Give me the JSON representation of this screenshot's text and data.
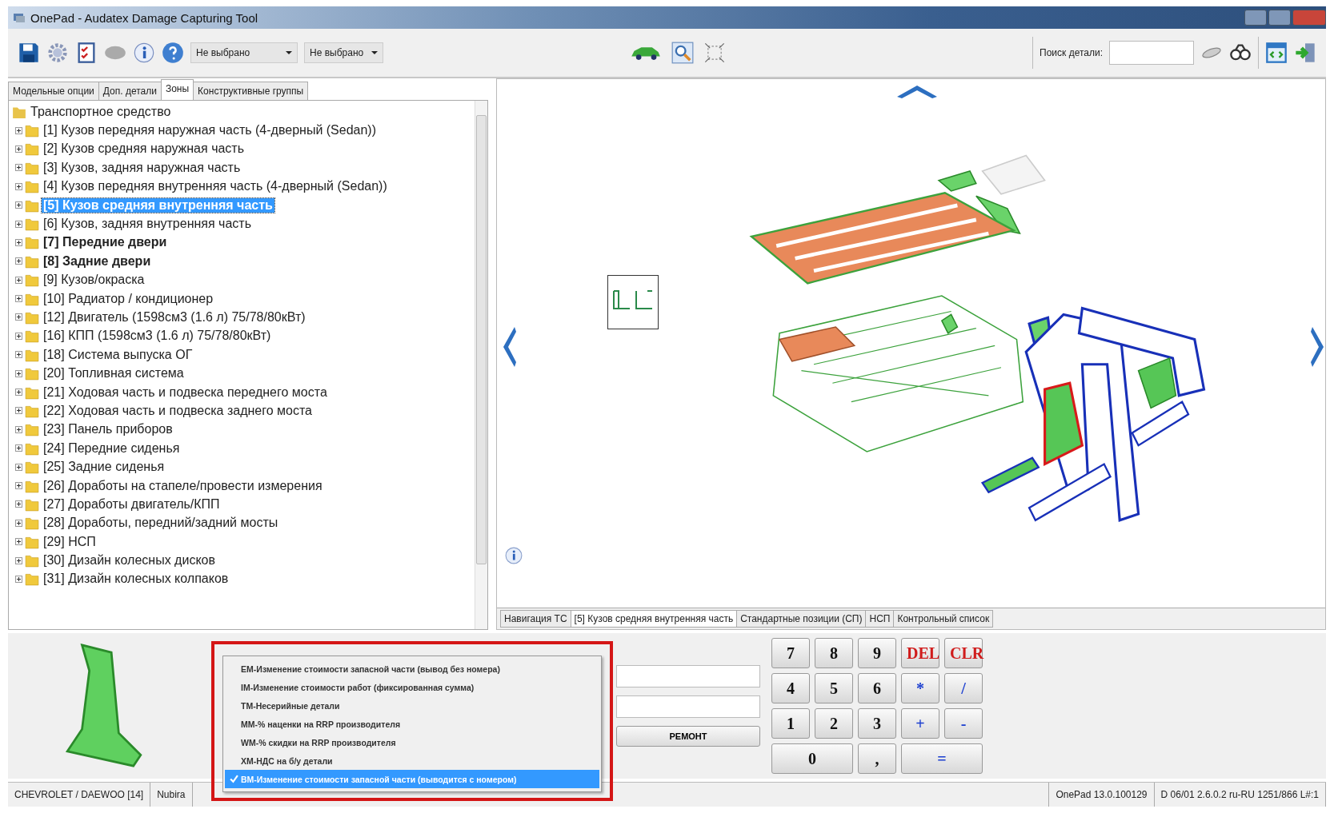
{
  "window": {
    "title": "OnePad - Audatex Damage Capturing Tool"
  },
  "toolbar": {
    "dropdowns": [
      "Не выбрано",
      "Не выбрано"
    ],
    "search_label": "Поиск детали:"
  },
  "left_tabs": [
    {
      "label": "Модельные опции",
      "selected": false
    },
    {
      "label": "Доп. детали",
      "selected": false
    },
    {
      "label": "Зоны",
      "selected": true
    },
    {
      "label": "Конструктивные группы",
      "selected": false
    }
  ],
  "tree": {
    "label": "Транспортное средство",
    "children": [
      {
        "label": "[1] Кузов передняя наружная часть (4-дверный (Sedan))",
        "selected": false,
        "bold": false
      },
      {
        "label": "[2] Кузов средняя наружная часть",
        "selected": false,
        "bold": false
      },
      {
        "label": "[3] Кузов, задняя наружная часть",
        "selected": false,
        "bold": false
      },
      {
        "label": "[4] Кузов передняя внутренняя часть (4-дверный (Sedan))",
        "selected": false,
        "bold": false
      },
      {
        "label": "[5] Кузов средняя внутренняя часть",
        "selected": true,
        "bold": true
      },
      {
        "label": "[6] Кузов, задняя внутренняя часть",
        "selected": false,
        "bold": false
      },
      {
        "label": "[7] Передние двери",
        "selected": false,
        "bold": true
      },
      {
        "label": "[8] Задние двери",
        "selected": false,
        "bold": true
      },
      {
        "label": "[9] Кузов/окраска",
        "selected": false,
        "bold": false
      },
      {
        "label": "[10] Радиатор / кондиционер",
        "selected": false,
        "bold": false
      },
      {
        "label": "[12] Двигатель (1598см3 (1.6 л) 75/78/80кВт)",
        "selected": false,
        "bold": false
      },
      {
        "label": "[16] КПП (1598см3 (1.6 л) 75/78/80кВт)",
        "selected": false,
        "bold": false
      },
      {
        "label": "[18] Система выпуска ОГ",
        "selected": false,
        "bold": false
      },
      {
        "label": "[20] Топливная система",
        "selected": false,
        "bold": false
      },
      {
        "label": "[21] Ходовая часть и подвеска переднего моста",
        "selected": false,
        "bold": false
      },
      {
        "label": "[22] Ходовая часть и подвеска заднего моста",
        "selected": false,
        "bold": false
      },
      {
        "label": "[23] Панель приборов",
        "selected": false,
        "bold": false
      },
      {
        "label": "[24] Передние сиденья",
        "selected": false,
        "bold": false
      },
      {
        "label": "[25] Задние сиденья",
        "selected": false,
        "bold": false
      },
      {
        "label": "[26] Доработы на стапеле/провести измерения",
        "selected": false,
        "bold": false
      },
      {
        "label": "[27] Доработы двигатель/КПП",
        "selected": false,
        "bold": false
      },
      {
        "label": "[28] Доработы, передний/задний мосты",
        "selected": false,
        "bold": false
      },
      {
        "label": "[29] НСП",
        "selected": false,
        "bold": false
      },
      {
        "label": "[30] Дизайн колесных дисков",
        "selected": false,
        "bold": false
      },
      {
        "label": "[31] Дизайн колесных колпаков",
        "selected": false,
        "bold": false
      }
    ]
  },
  "view_tabs": [
    {
      "label": "Навигация ТС",
      "selected": false
    },
    {
      "label": "[5] Кузов средняя внутренняя часть",
      "selected": true
    },
    {
      "label": "Стандартные позиции (СП)",
      "selected": false
    },
    {
      "label": "НСП",
      "selected": false
    },
    {
      "label": "Контрольный список",
      "selected": false
    }
  ],
  "repair_button": "РЕМОНТ",
  "keypad": [
    {
      "label": "7",
      "kind": "digit",
      "wide": false
    },
    {
      "label": "8",
      "kind": "digit",
      "wide": false
    },
    {
      "label": "9",
      "kind": "digit",
      "wide": false
    },
    {
      "label": "DEL",
      "kind": "command",
      "wide": false
    },
    {
      "label": "CLR",
      "kind": "command",
      "wide": false
    },
    {
      "label": "4",
      "kind": "digit",
      "wide": false
    },
    {
      "label": "5",
      "kind": "digit",
      "wide": false
    },
    {
      "label": "6",
      "kind": "digit",
      "wide": false
    },
    {
      "label": "*",
      "kind": "operator",
      "wide": false
    },
    {
      "label": "/",
      "kind": "operator",
      "wide": false
    },
    {
      "label": "1",
      "kind": "digit",
      "wide": false
    },
    {
      "label": "2",
      "kind": "digit",
      "wide": false
    },
    {
      "label": "3",
      "kind": "digit",
      "wide": false
    },
    {
      "label": "+",
      "kind": "operator",
      "wide": false
    },
    {
      "label": "-",
      "kind": "operator",
      "wide": false
    },
    {
      "label": "0",
      "kind": "digit",
      "wide": true
    },
    {
      "label": ",",
      "kind": "digit",
      "wide": false
    },
    {
      "label": "=",
      "kind": "operator",
      "wide": true
    }
  ],
  "popup_menu": [
    {
      "label": "EM-Изменение стоимости запасной части (вывод без номера)",
      "selected": false
    },
    {
      "label": "IM-Изменение стоимости работ (фиксированная сумма)",
      "selected": false
    },
    {
      "label": "TM-Несерийные детали",
      "selected": false
    },
    {
      "label": "MM-% наценки на RRP производителя",
      "selected": false
    },
    {
      "label": "WM-% скидки на RRP производителя",
      "selected": false
    },
    {
      "label": "XM-НДС на б/у детали",
      "selected": false
    },
    {
      "label": "BM-Изменение стоимости запасной части (выводится с номером)",
      "selected": true
    }
  ],
  "status_bar": {
    "left": [
      "CHEVROLET / DAEWOO [14]",
      "Nubira"
    ],
    "right": [
      "OnePad 13.0.100129",
      "D 06/01 2.6.0.2 ru-RU 1251/866 L#:1"
    ]
  }
}
